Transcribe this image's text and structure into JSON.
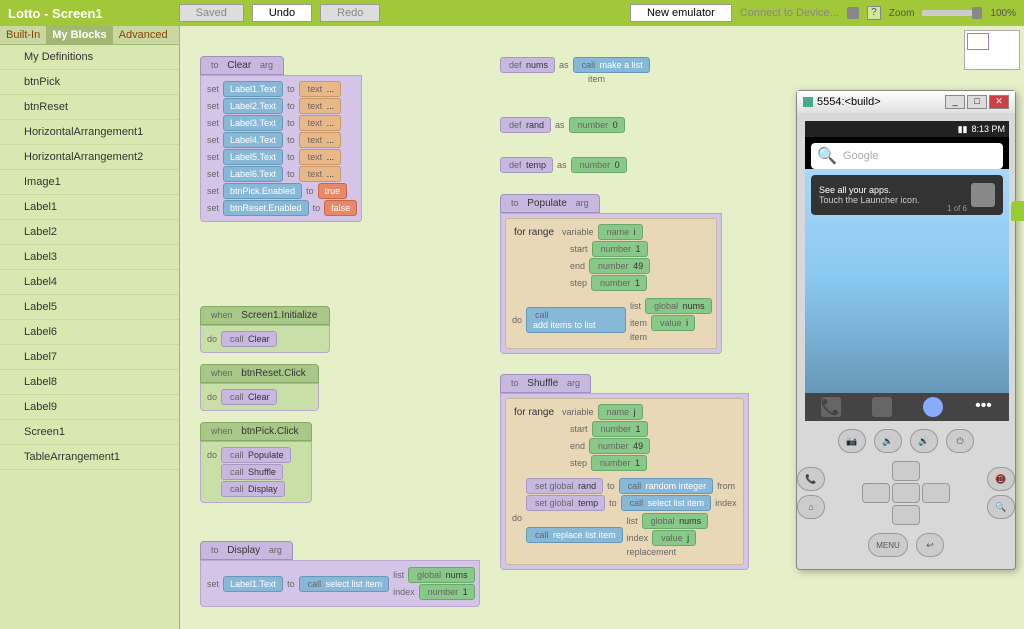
{
  "topbar": {
    "title": "Lotto - Screen1",
    "saved": "Saved",
    "undo": "Undo",
    "redo": "Redo",
    "new_emulator": "New emulator",
    "connect": "Connect to Device...",
    "zoom": "Zoom",
    "zoom_pct": "100%"
  },
  "tabs": {
    "builtin": "Built-In",
    "myblocks": "My Blocks",
    "advanced": "Advanced"
  },
  "sidebar": [
    "My Definitions",
    "btnPick",
    "btnReset",
    "HorizontalArrangement1",
    "HorizontalArrangement2",
    "Image1",
    "Label1",
    "Label2",
    "Label3",
    "Label4",
    "Label5",
    "Label6",
    "Label7",
    "Label8",
    "Label9",
    "Screen1",
    "TableArrangement1"
  ],
  "clear_block": {
    "name": "Clear",
    "arg": "arg",
    "rows": [
      {
        "prop": "Label1.Text",
        "val": "text",
        "v2": "..."
      },
      {
        "prop": "Label2.Text",
        "val": "text",
        "v2": "..."
      },
      {
        "prop": "Label3.Text",
        "val": "text",
        "v2": "..."
      },
      {
        "prop": "Label4.Text",
        "val": "text",
        "v2": "..."
      },
      {
        "prop": "Label5.Text",
        "val": "text",
        "v2": "..."
      },
      {
        "prop": "Label6.Text",
        "val": "text",
        "v2": "..."
      }
    ],
    "pick": {
      "prop": "btnPick.Enabled",
      "val": "true"
    },
    "reset": {
      "prop": "btnReset.Enabled",
      "val": "false"
    }
  },
  "defs": {
    "nums": {
      "name": "nums",
      "as": "as",
      "call": "make a list",
      "sub": "item"
    },
    "rand": {
      "name": "rand",
      "as": "as",
      "val": "0",
      "type": "number"
    },
    "temp": {
      "name": "temp",
      "as": "as",
      "val": "0",
      "type": "number"
    }
  },
  "populate": {
    "name": "Populate",
    "arg": "arg",
    "loop": "for range",
    "var": "variable",
    "varname": "i",
    "start": "start",
    "startval": "1",
    "end": "end",
    "endval": "49",
    "step": "step",
    "stepval": "1",
    "call": "add items to list",
    "list": "list",
    "g1": "nums",
    "item": "item",
    "g2": "i",
    "sub": "item"
  },
  "shuffle": {
    "name": "Shuffle",
    "arg": "arg",
    "loop": "for range",
    "var": "variable",
    "varname": "j",
    "start": "start",
    "startval": "1",
    "end": "end",
    "endval": "49",
    "step": "step",
    "stepval": "1",
    "rand": "rand",
    "randcall": "random integer",
    "from": "from",
    "temp": "temp",
    "tempcall": "select list item",
    "index": "index",
    "replace": "replace list item",
    "list": "list",
    "g1": "nums",
    "g2": "j"
  },
  "events": {
    "screen_init": {
      "when": "Screen1.Initialize",
      "do": "do",
      "call": "Clear"
    },
    "reset_click": {
      "when": "btnReset.Click",
      "do": "do",
      "call": "Clear"
    },
    "pick_click": {
      "when": "btnPick.Click",
      "do": "do",
      "c1": "Populate",
      "c2": "Shuffle",
      "c3": "Display"
    }
  },
  "display": {
    "name": "Display",
    "arg": "arg",
    "prop": "Label1.Text",
    "call": "select list item",
    "list": "list",
    "g": "nums",
    "index": "index",
    "idxval": "1"
  },
  "labels": {
    "set": "set",
    "to": "to",
    "do": "do",
    "call": "call",
    "when": "when",
    "def": "def",
    "global": "global",
    "value": "value",
    "number": "number",
    "name": "name",
    "text": "text",
    "replacement": "replacement",
    "set_global": "set global"
  },
  "emulator": {
    "title": "5554:<build>",
    "time": "8:13 PM",
    "search": "Google",
    "hint_title": "See all your apps.",
    "hint_sub": "Touch the Launcher icon.",
    "hint_page": "1 of 6",
    "menu": "MENU"
  }
}
